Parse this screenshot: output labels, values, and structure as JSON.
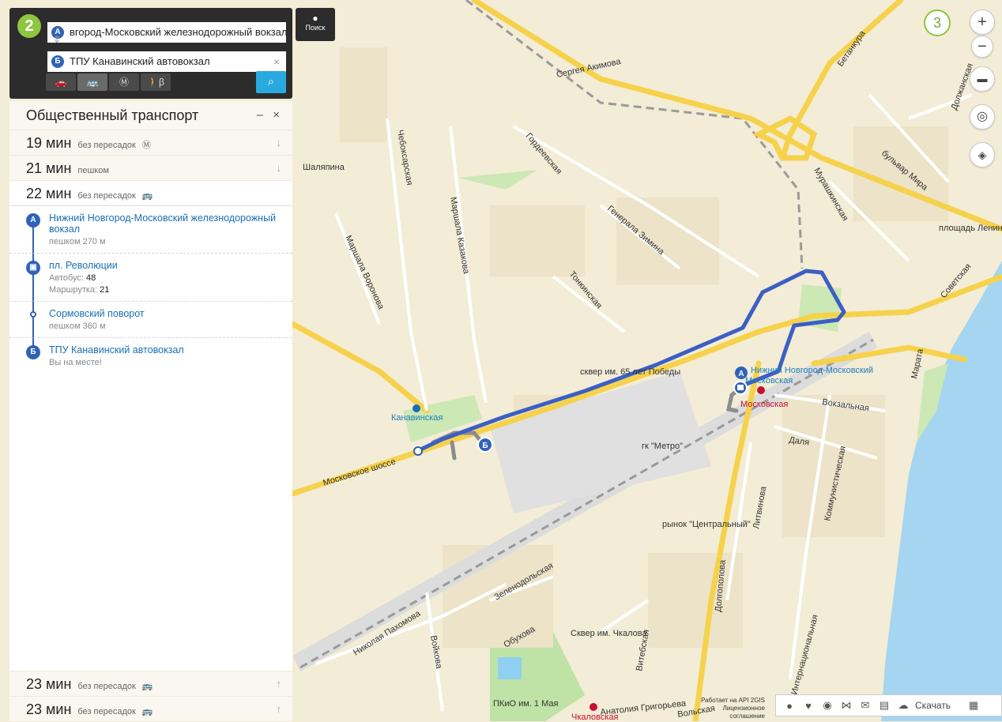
{
  "search": {
    "from_value": "вгород-Московский железнодорожный вокзал",
    "to_value": "ТПУ Канавинский автовокзал",
    "from_marker": "А",
    "to_marker": "Б",
    "clear_icon": "×",
    "search_button_label": "Поиск",
    "modes": [
      {
        "name": "car-icon",
        "glyph": "🚗"
      },
      {
        "name": "bus-icon",
        "glyph": "🚌"
      },
      {
        "name": "metro-icon",
        "glyph": "Ⓜ"
      },
      {
        "name": "walk-icon",
        "glyph": "🚶β"
      }
    ]
  },
  "logo": "2",
  "panel": {
    "title": "Общественный транспорт",
    "controls": "– ×",
    "routes_top": [
      {
        "time": "19 мин",
        "note": "без пересадок",
        "icon": "Ⓜ",
        "arrow": "↓"
      },
      {
        "time": "21 мин",
        "note": "пешком",
        "icon": "",
        "arrow": "↓"
      },
      {
        "time": "22 мин",
        "note": "без пересадок",
        "icon": "🚌",
        "arrow": ""
      }
    ],
    "steps": [
      {
        "marker": "А",
        "title": "Нижний Новгород-Московский железнодорожный вокзал",
        "sub": "пешком 270 м"
      },
      {
        "marker": "🚌",
        "title": "пл. Революции",
        "line1_label": "Автобус:",
        "line1_value": "48",
        "line2_label": "Маршрутка:",
        "line2_value": "21"
      },
      {
        "marker": "",
        "title": "Сормовский поворот",
        "sub": "пешком 360 м"
      },
      {
        "marker": "Б",
        "title": "ТПУ Канавинский автовокзал",
        "sub": "Вы на месте!"
      }
    ],
    "routes_bottom": [
      {
        "time": "23 мин",
        "note": "без пересадок",
        "icon": "🚌",
        "arrow": "↑"
      },
      {
        "time": "23 мин",
        "note": "без пересадок",
        "icon": "🚌",
        "arrow": "↑"
      }
    ]
  },
  "map": {
    "zoom_level": "3",
    "zoom_in": "+",
    "zoom_out": "−",
    "streets": [
      "Сергея Акимова",
      "Бетанкура",
      "Шаляпина",
      "Чебоксарская",
      "Гордеевская",
      "Маршала Казакова",
      "Маршала Воронова",
      "Генерала Зимина",
      "Тонкинская",
      "Мурашкинская",
      "бульвар Мира",
      "площадь Ленина",
      "Советская",
      "Московское шоссе",
      "Вокзальная",
      "Даля",
      "Коммунистическая",
      "Марата",
      "Литвинова",
      "Долгополова",
      "Интернациональная",
      "Анатолия Григорьева",
      "Витебская",
      "Обухова",
      "Зеленодольская",
      "Николая Пахомова",
      "Войкова",
      "Должанская",
      "сквер им. 65 лет Победы",
      "гк \"Метро\"",
      "рынок \"Центральный\"",
      "Сквер им. Чкалова",
      "ПКиО им. 1 Мая",
      "Вольская",
      "Канавинская",
      "Московская",
      "Чкаловская"
    ],
    "highlight_station": "Нижний Новгород-Московский",
    "highlight_station_2": "Московская",
    "route_color": "#3b5fc4",
    "water_color": "#a5d5f0"
  },
  "footer": {
    "download_label": "Скачать",
    "credit_line1": "Работает на API 2GIS",
    "credit_line2": "Лицензионное соглашение"
  }
}
